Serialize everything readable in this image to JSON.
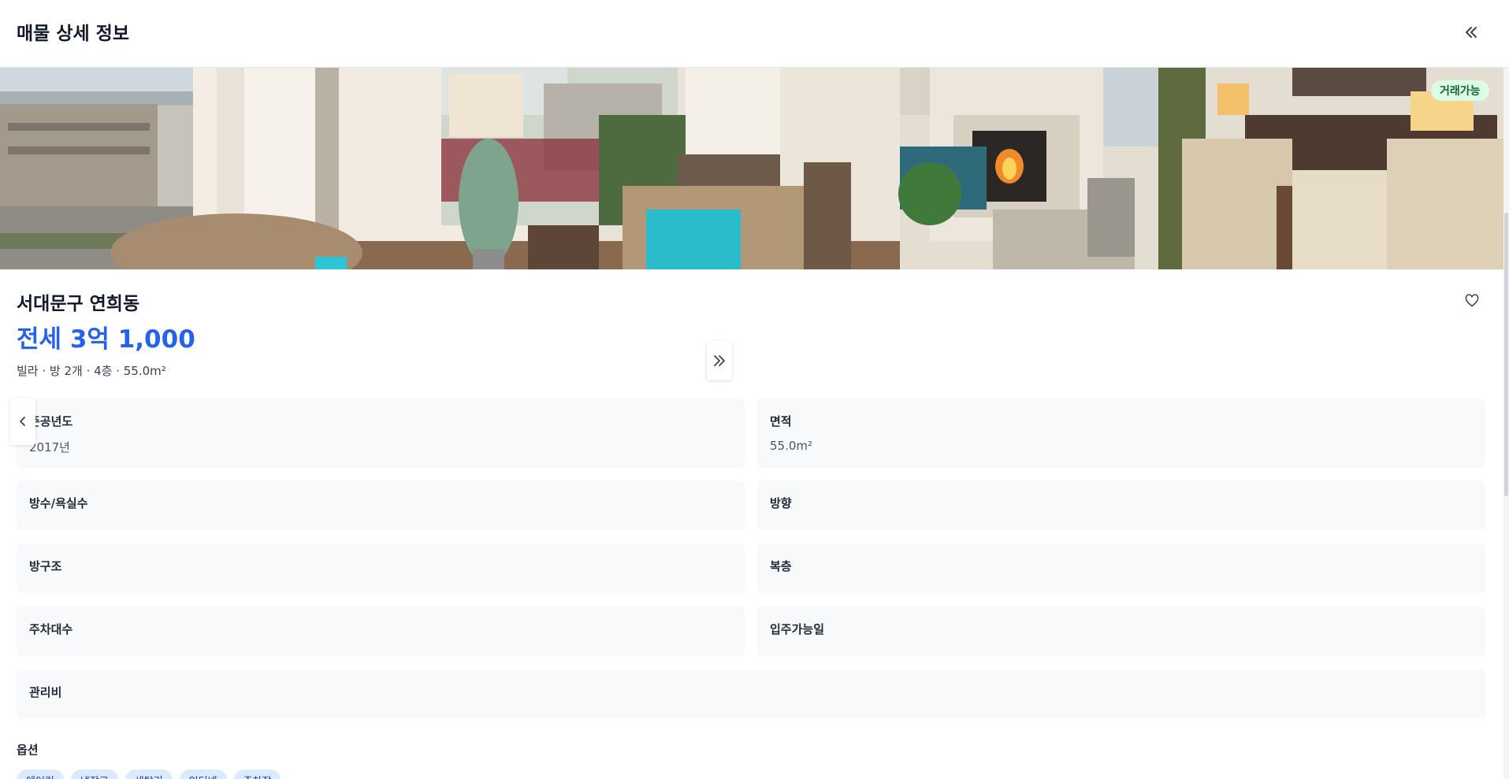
{
  "header": {
    "title": "매물 상세 정보"
  },
  "listing": {
    "status_badge": "거래가능",
    "district": "서대문구 연희동",
    "price": "전세 3억 1,000",
    "summary": "빌라 · 방 2개 · 4층 · 55.0m²"
  },
  "details": {
    "built_year": {
      "label": "준공년도",
      "value": "2017년"
    },
    "area": {
      "label": "면적",
      "value": "55.0m²"
    },
    "rooms_baths": {
      "label": "방수/욕실수",
      "value": ""
    },
    "direction": {
      "label": "방향",
      "value": ""
    },
    "room_structure": {
      "label": "방구조",
      "value": ""
    },
    "duplex": {
      "label": "복층",
      "value": ""
    },
    "parking": {
      "label": "주차대수",
      "value": ""
    },
    "move_in_date": {
      "label": "입주가능일",
      "value": ""
    },
    "maintenance_fee": {
      "label": "관리비",
      "value": ""
    }
  },
  "options": {
    "title": "옵션",
    "items": [
      "에어컨",
      "냉장고",
      "세탁기",
      "인터넷",
      "주차장"
    ]
  },
  "icons": {
    "collapse": "double-chevron-left-icon",
    "expand": "double-chevron-right-icon",
    "prev": "chevron-left-icon",
    "favorite": "heart-icon"
  },
  "colors": {
    "accent": "#2563eb",
    "badge_bg": "#dcfce7",
    "badge_text": "#166534",
    "chip_bg": "#dbeafe",
    "card_bg": "#f8f9fb"
  }
}
